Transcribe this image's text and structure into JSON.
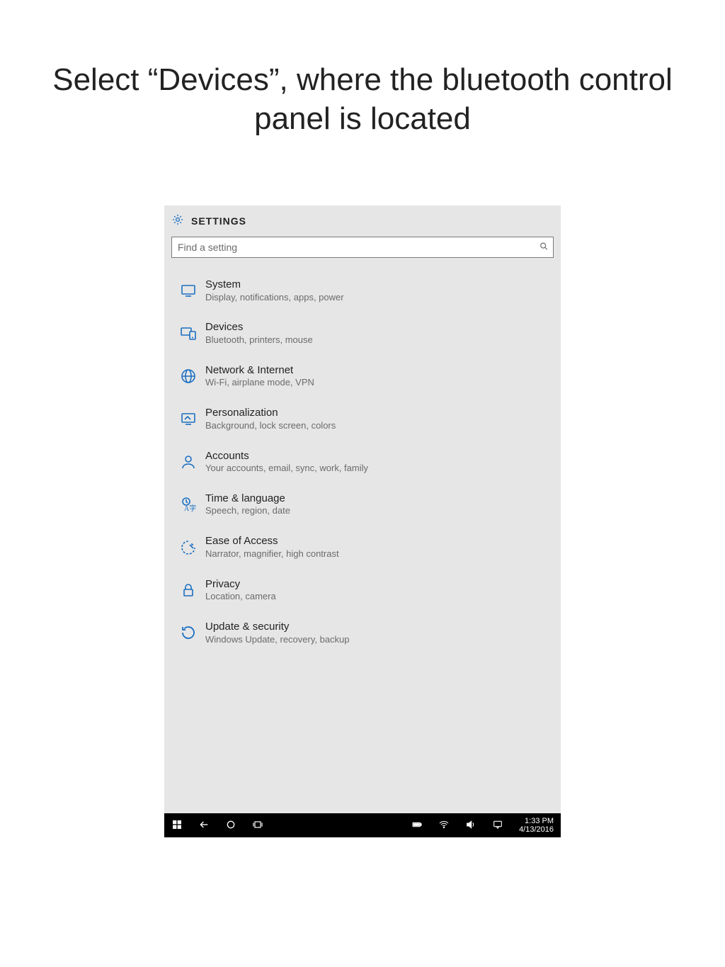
{
  "slide": {
    "title": "Select “Devices”, where the bluetooth control panel is located"
  },
  "settings": {
    "header_title": "SETTINGS",
    "search_placeholder": "Find a setting",
    "items": [
      {
        "name": "System",
        "desc": "Display, notifications, apps, power"
      },
      {
        "name": "Devices",
        "desc": "Bluetooth, printers, mouse"
      },
      {
        "name": "Network & Internet",
        "desc": "Wi-Fi, airplane mode, VPN"
      },
      {
        "name": "Personalization",
        "desc": "Background, lock screen, colors"
      },
      {
        "name": "Accounts",
        "desc": "Your accounts, email, sync, work, family"
      },
      {
        "name": "Time & language",
        "desc": "Speech, region, date"
      },
      {
        "name": "Ease of Access",
        "desc": "Narrator, magnifier, high contrast"
      },
      {
        "name": "Privacy",
        "desc": "Location, camera"
      },
      {
        "name": "Update & security",
        "desc": "Windows Update, recovery, backup"
      }
    ]
  },
  "taskbar": {
    "time": "1:33 PM",
    "date": "4/13/2016"
  }
}
